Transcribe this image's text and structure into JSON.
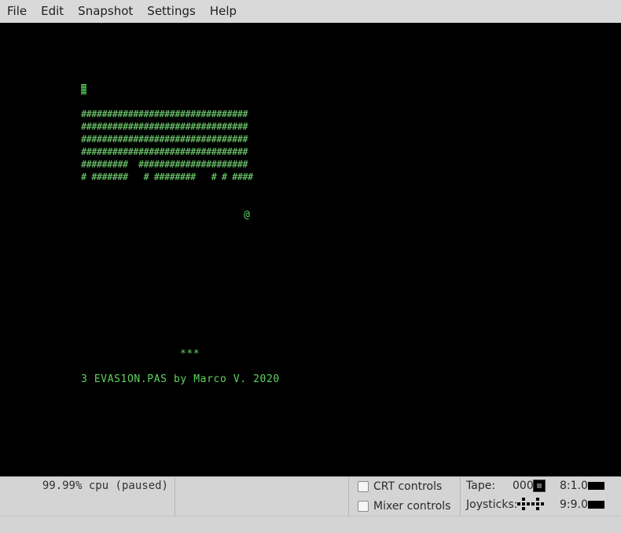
{
  "menu": [
    "File",
    "Edit",
    "Snapshot",
    "Settings",
    "Help"
  ],
  "screen": {
    "brick_rows": [
      "################################",
      "################################",
      "################################",
      "################################",
      "#########  #####################",
      "# #######   # ########   # # ####"
    ],
    "ball": "@",
    "paddle": "***",
    "footer_text": "3 EVAS1ON.PAS by Marco V. 2020"
  },
  "status": {
    "cpu": "99.99% cpu (paused)",
    "crt_controls": "CRT controls",
    "mixer_controls": "Mixer controls",
    "tape_label": "Tape:",
    "tape_value": "000",
    "tape_speed": "8:1.0",
    "joysticks_label": "Joysticks:",
    "joysticks_value": "9:9.0"
  },
  "colors": {
    "screen_bg": "#000000",
    "text_green": "#5fd35f"
  }
}
